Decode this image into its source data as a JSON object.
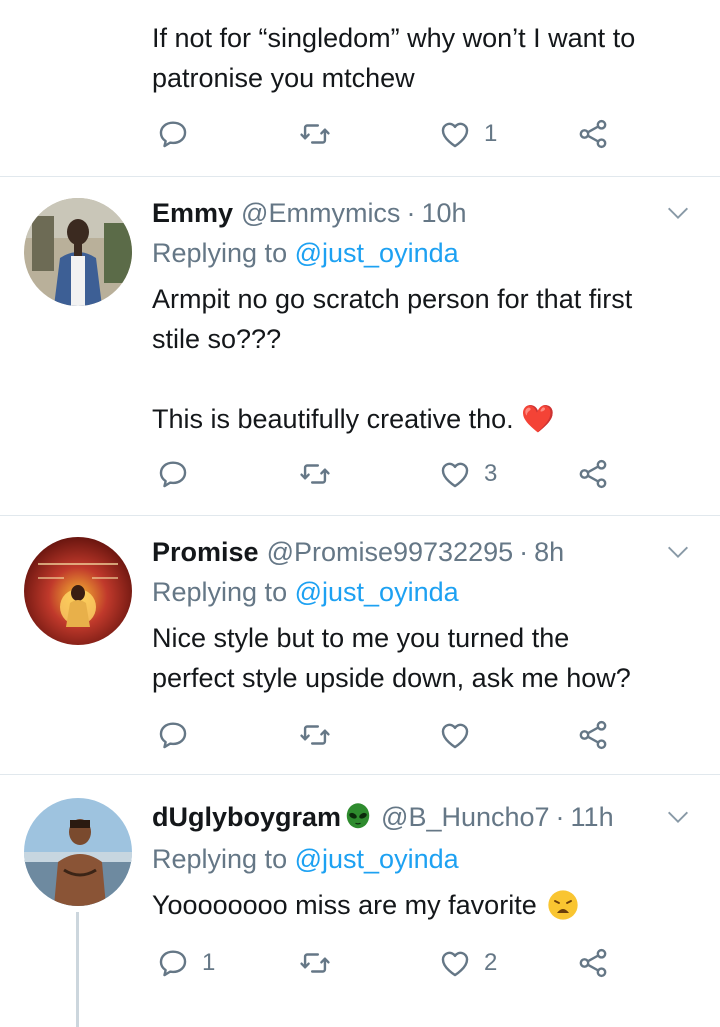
{
  "tweets": [
    {
      "text_lines": [
        "If not for “singledom” why won’t I want to",
        "patronise you mtchew"
      ],
      "counts": {
        "replies": "",
        "retweets": "",
        "likes": "1"
      }
    },
    {
      "name": "Emmy",
      "handle": "@Emmymics",
      "dot": "·",
      "time": "10h",
      "replying_prefix": "Replying to",
      "replying_to": "@just_oyinda",
      "text_lines": [
        "Armpit no go scratch person for that first",
        "stile so???",
        "",
        "This is beautifully creative tho."
      ],
      "emoji": "❤️",
      "counts": {
        "replies": "",
        "retweets": "",
        "likes": "3"
      }
    },
    {
      "name": "Promise",
      "handle": "@Promise99732295",
      "dot": "·",
      "time": "8h",
      "replying_prefix": "Replying to",
      "replying_to": "@just_oyinda",
      "text_lines": [
        "Nice style but to me you turned the",
        "perfect style upside down, ask me how?"
      ],
      "counts": {
        "replies": "",
        "retweets": "",
        "likes": ""
      }
    },
    {
      "name": "dUglyboygram",
      "handle": "@B_Huncho7",
      "dot": "·",
      "time": "11h",
      "replying_prefix": "Replying to",
      "replying_to": "@just_oyinda",
      "text_lines": [
        "Yoooooooo miss are my favorite"
      ],
      "counts": {
        "replies": "1",
        "retweets": "",
        "likes": "2"
      }
    }
  ],
  "colors": {
    "accent": "#1da1f2",
    "secondary_text": "#657786",
    "divider": "#e1e8ed",
    "heart": "#e0245e",
    "alien": "#2e8b2e"
  },
  "icons": [
    "reply-icon",
    "retweet-icon",
    "like-icon",
    "share-icon",
    "chevron-down-icon",
    "alien-emoji-icon",
    "weary-emoji-icon"
  ]
}
